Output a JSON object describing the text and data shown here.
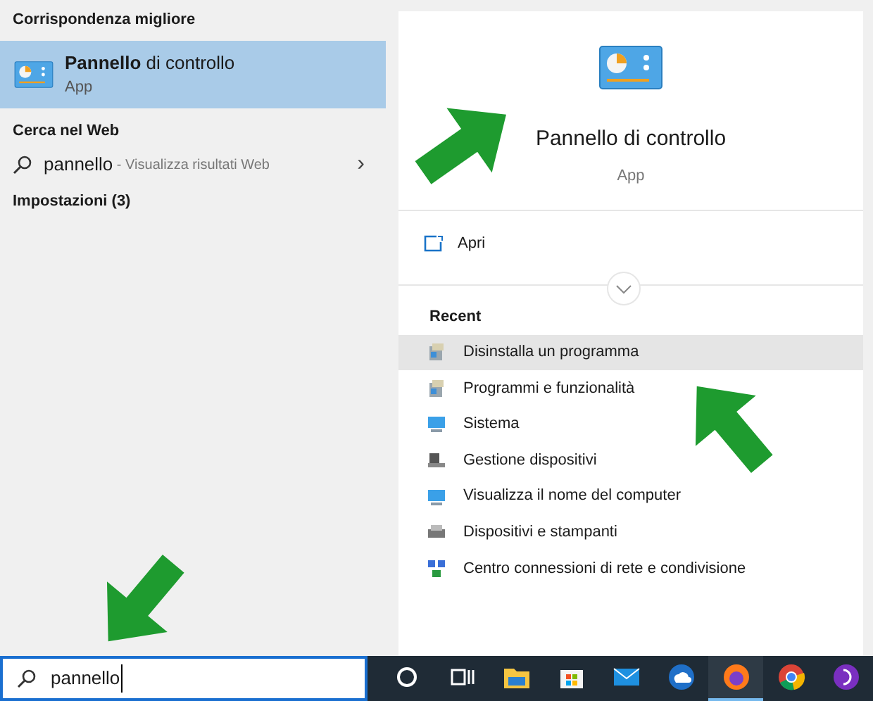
{
  "left_panel": {
    "best_match_header": "Corrispondenza migliore",
    "best_match": {
      "title": "**Pannello** di controllo",
      "subtitle": "App",
      "selected": true
    },
    "web_header": "Cerca nel Web",
    "web_result": {
      "query": "pannello",
      "hint": " - Visualizza risultati Web",
      "arrow": "›"
    },
    "settings_header": "Impostazioni (3)"
  },
  "detail": {
    "title": "Pannello di controllo",
    "subtitle": "App",
    "open_label": "Apri",
    "recent_header": "Recent",
    "recent": [
      {
        "label": "Disinstalla un programma",
        "kind": "programs",
        "selected": true
      },
      {
        "label": "Programmi e funzionalità",
        "kind": "programs",
        "selected": false
      },
      {
        "label": "Sistema",
        "kind": "system",
        "selected": false
      },
      {
        "label": "Gestione dispositivi",
        "kind": "devices",
        "selected": false
      },
      {
        "label": "Visualizza il nome del computer",
        "kind": "system",
        "selected": false
      },
      {
        "label": "Dispositivi e stampanti",
        "kind": "printer",
        "selected": false
      },
      {
        "label": "Centro connessioni di rete e condivisione",
        "kind": "network",
        "selected": false
      }
    ]
  },
  "search": {
    "value": "pannello"
  },
  "taskbar": [
    {
      "kind": "cortana",
      "selected": false
    },
    {
      "kind": "taskview",
      "selected": false
    },
    {
      "kind": "folder",
      "selected": false
    },
    {
      "kind": "store",
      "selected": false
    },
    {
      "kind": "mail",
      "selected": false
    },
    {
      "kind": "cloud",
      "selected": false
    },
    {
      "kind": "firefox",
      "selected": true
    },
    {
      "kind": "chrome",
      "selected": false
    },
    {
      "kind": "purple",
      "selected": false
    }
  ]
}
